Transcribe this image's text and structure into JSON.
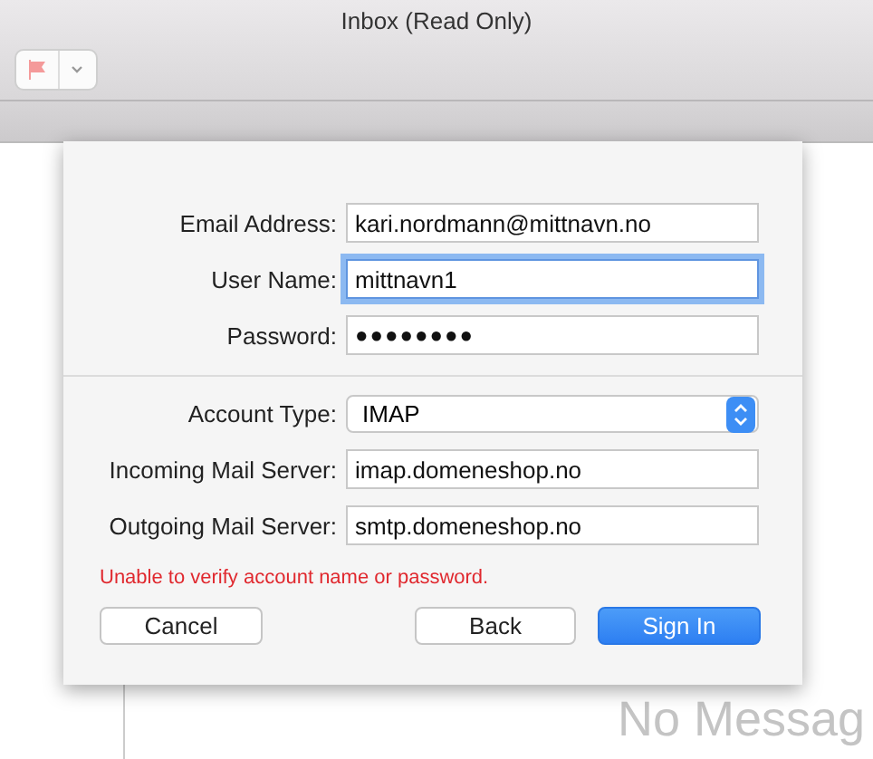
{
  "window": {
    "title": "Inbox (Read Only)"
  },
  "toolbar": {
    "flag_button": {
      "has_dropdown": true
    }
  },
  "message_list": {
    "empty_text": "No Messag"
  },
  "sheet": {
    "sections": [
      {
        "fields": [
          {
            "label": "Email Address:",
            "kind": "text",
            "value": "kari.nordmann@mittnavn.no",
            "focused": false
          },
          {
            "label": "User Name:",
            "kind": "text",
            "value": "mittnavn1",
            "focused": true
          },
          {
            "label": "Password:",
            "kind": "password",
            "value": "●●●●●●●●",
            "focused": false
          }
        ]
      },
      {
        "fields": [
          {
            "label": "Account Type:",
            "kind": "select",
            "value": "IMAP",
            "focused": false
          },
          {
            "label": "Incoming Mail Server:",
            "kind": "text",
            "value": "imap.domeneshop.no",
            "focused": false
          },
          {
            "label": "Outgoing Mail Server:",
            "kind": "text",
            "value": "smtp.domeneshop.no",
            "focused": false
          }
        ]
      }
    ],
    "error": "Unable to verify account name or password.",
    "buttons": [
      {
        "label": "Cancel",
        "default": false
      },
      {
        "label": "Back",
        "default": false
      },
      {
        "label": "Sign In",
        "default": true
      }
    ]
  }
}
